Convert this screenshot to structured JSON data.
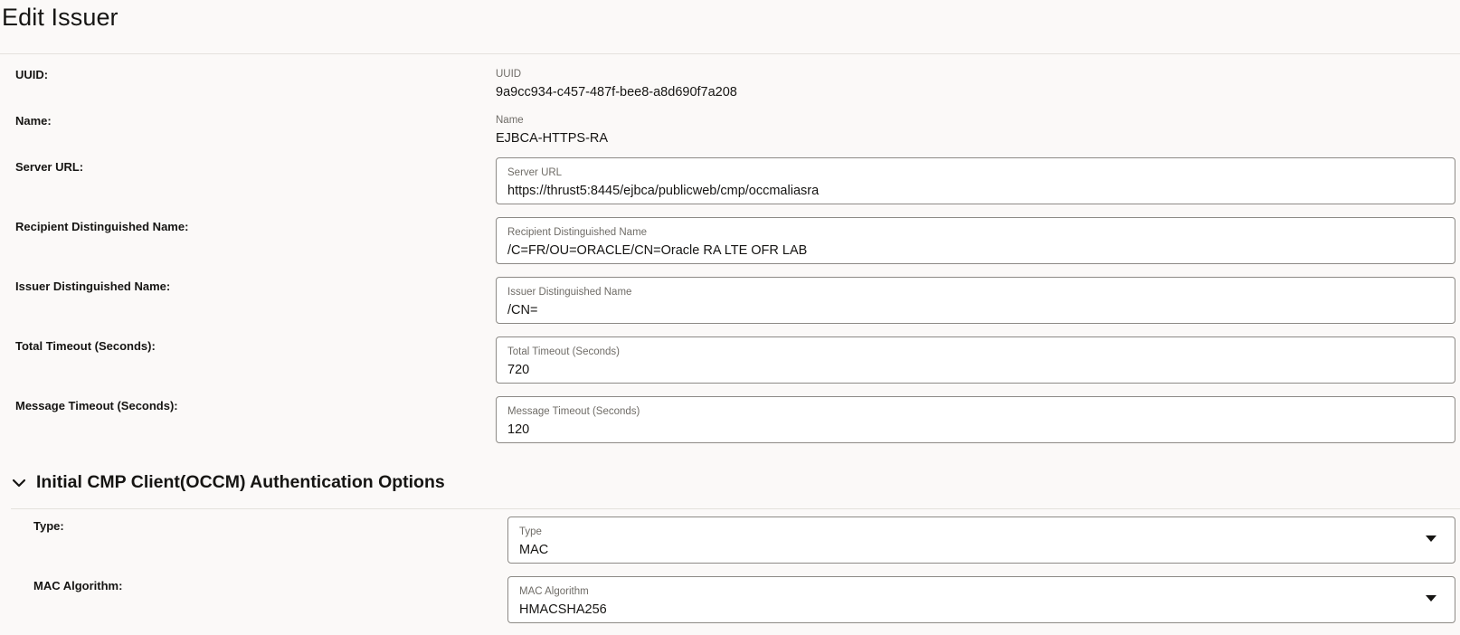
{
  "page": {
    "title": "Edit Issuer"
  },
  "fields": {
    "uuid": {
      "row_label": "UUID:",
      "label": "UUID",
      "value": "9a9cc934-c457-487f-bee8-a8d690f7a208"
    },
    "name": {
      "row_label": "Name:",
      "label": "Name",
      "value": "EJBCA-HTTPS-RA"
    },
    "server_url": {
      "row_label": "Server URL:",
      "label": "Server URL",
      "value": "https://thrust5:8445/ejbca/publicweb/cmp/occmaliasra"
    },
    "recipient_dn": {
      "row_label": "Recipient Distinguished Name:",
      "label": "Recipient Distinguished Name",
      "value": "/C=FR/OU=ORACLE/CN=Oracle RA LTE OFR LAB"
    },
    "issuer_dn": {
      "row_label": "Issuer Distinguished Name:",
      "label": "Issuer Distinguished Name",
      "value": "/CN="
    },
    "total_timeout": {
      "row_label": "Total Timeout (Seconds):",
      "label": "Total Timeout (Seconds)",
      "value": "720"
    },
    "message_timeout": {
      "row_label": "Message Timeout (Seconds):",
      "label": "Message Timeout (Seconds)",
      "value": "120"
    }
  },
  "auth_section": {
    "title": "Initial CMP Client(OCCM) Authentication Options",
    "expanded": true,
    "type": {
      "row_label": "Type:",
      "label": "Type",
      "value": "MAC"
    },
    "mac_algorithm": {
      "row_label": "MAC Algorithm:",
      "label": "MAC Algorithm",
      "value": "HMACSHA256"
    }
  },
  "icons": {
    "section_toggle": "chevron-down-icon",
    "select_caret": "caret-down-icon"
  },
  "colors": {
    "background": "#fbf9f8",
    "field_border": "#8d8a86",
    "label_muted": "#6f6c67",
    "text": "#161513"
  }
}
